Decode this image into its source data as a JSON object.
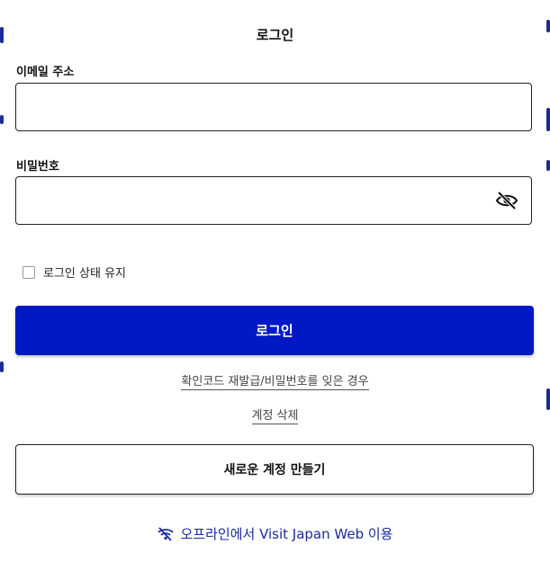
{
  "header": {
    "title": "로그인"
  },
  "form": {
    "email": {
      "label": "이메일 주소",
      "value": "",
      "placeholder": ""
    },
    "password": {
      "label": "비밀번호",
      "value": "",
      "placeholder": "",
      "toggle_icon": "eye-slash-icon"
    },
    "remember": {
      "label": "로그인 상태 유지",
      "checked": false
    },
    "submit_label": "로그인"
  },
  "links": {
    "reissue": "확인코드 재발급/비밀번호를 잊은 경우",
    "delete_account": "계정 삭제"
  },
  "create_account_label": "새로운 계정 만들기",
  "offline": {
    "icon": "wifi-off-icon",
    "label": "오프라인에서 Visit Japan Web 이용"
  },
  "colors": {
    "primary": "#0019c4",
    "link_accent": "#1a2a9a",
    "border": "#222222"
  }
}
